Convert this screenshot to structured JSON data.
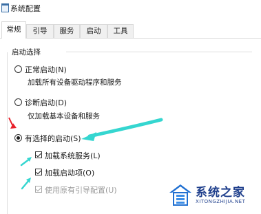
{
  "window": {
    "title": "系统配置",
    "icon": "system-config-icon"
  },
  "tabs": [
    {
      "label": "常规",
      "active": true
    },
    {
      "label": "引导",
      "active": false
    },
    {
      "label": "服务",
      "active": false
    },
    {
      "label": "启动",
      "active": false
    },
    {
      "label": "工具",
      "active": false
    }
  ],
  "startup_group": {
    "title": "启动选择",
    "normal": {
      "label": "正常启动(N)",
      "desc": "加载所有设备驱动程序和服务",
      "checked": false
    },
    "diagnostic": {
      "label": "诊断启动(D)",
      "desc": "仅加载基本设备和服务",
      "checked": false
    },
    "selective": {
      "label": "有选择的启动(S)",
      "checked": true,
      "options": [
        {
          "label": "加载系统服务(L)",
          "checked": true,
          "enabled": true
        },
        {
          "label": "加载启动项(O)",
          "checked": true,
          "enabled": true
        },
        {
          "label": "使用原有引导配置(U)",
          "checked": true,
          "enabled": false
        }
      ]
    }
  },
  "annotation_colors": {
    "arrow_red": "#e8202a",
    "arrow_cyan": "#35d6d0"
  },
  "watermark": {
    "text": "系统之家",
    "sub": "XITONGZHIJIA.NET",
    "color": "#1f3f8c"
  }
}
